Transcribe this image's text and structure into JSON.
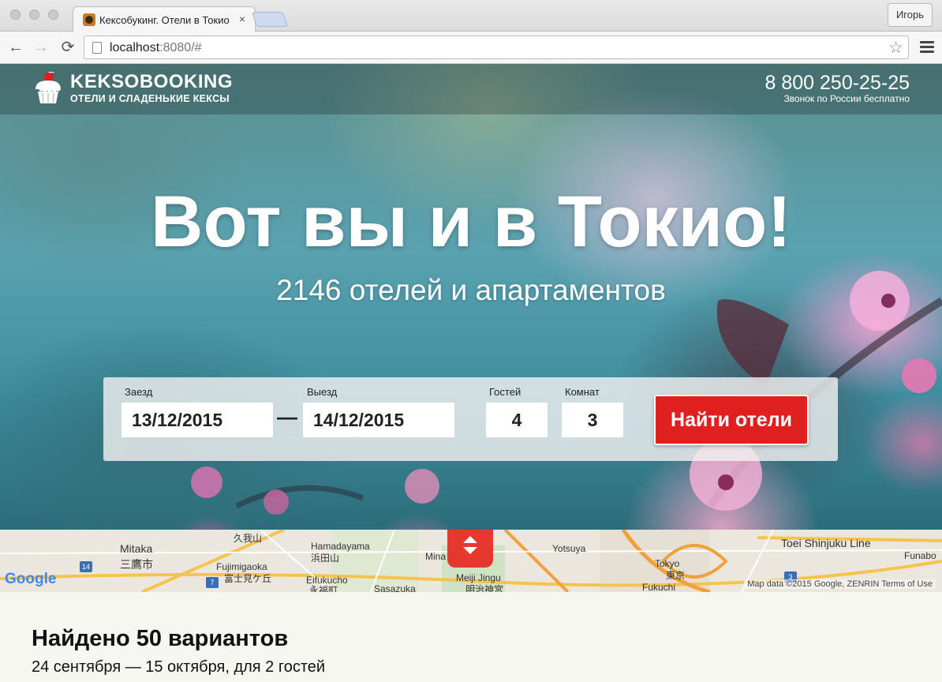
{
  "browser": {
    "tab_title": "Кексобукинг. Отели в Токио",
    "tab_close": "×",
    "profile_name": "Игорь",
    "url_host": "localhost",
    "url_rest": ":8080/#",
    "star_glyph": "☆",
    "back_glyph": "←",
    "forward_glyph": "→",
    "reload_glyph": "⟳"
  },
  "header": {
    "logo_name": "KEKSOBOOKING",
    "logo_tagline": "ОТЕЛИ И СЛАДЕНЬКИЕ КЕКСЫ",
    "phone": "8 800 250-25-25",
    "phone_note": "Звонок по России бесплатно"
  },
  "hero": {
    "title": "Вот вы и в Токио!",
    "subtitle": "2146 отелей и апартаментов"
  },
  "search": {
    "checkin_label": "Заезд",
    "checkin_value": "13/12/2015",
    "dash": "—",
    "checkout_label": "Выезд",
    "checkout_value": "14/12/2015",
    "guests_label": "Гостей",
    "guests_value": "4",
    "rooms_label": "Комнат",
    "rooms_value": "3",
    "submit_label": "Найти отели"
  },
  "map": {
    "labels": {
      "mitaka": "Mitaka",
      "mitaka_jp": "三鷹市",
      "hamadayama": "Hamadayama",
      "hamadayama_jp": "浜田山",
      "fujimigaoka": "Fujimigaoka",
      "fujimigaoka_jp": "富士見ケ丘",
      "eifukucho": "Eifukucho",
      "eifukucho_jp": "永福町",
      "sasazuka": "Sasazuka",
      "kugayama_jp": "久我山",
      "minami": "Mina",
      "meiji_jingu": "Meiji Jingu",
      "meiji_jingu_jp": "明治神宮",
      "yotsuya": "Yotsuya",
      "tokyo": "Tokyo",
      "tokyo_jp": "東京",
      "ebisu": "Fukuchi",
      "shinjuku_line": "Toei Shinjuku Line",
      "funabori": "Funabo"
    },
    "route_shields": [
      "14",
      "7",
      "3"
    ],
    "google_logo": "Google",
    "attribution": "Map data ©2015 Google, ZENRIN   Terms of Use"
  },
  "results": {
    "title": "Найдено 50 вариантов",
    "dates": "24 сентября  —  15 октября, для 2 гостей"
  },
  "colors": {
    "accent_red": "#e0201f",
    "map_toggle": "#e5392f",
    "page_background": "#f7f7f2"
  },
  "icons": [
    "cupcake-logo-icon",
    "favicon-icon",
    "back-arrow-icon",
    "forward-arrow-icon",
    "reload-icon",
    "page-icon",
    "bookmark-star-icon",
    "hamburger-menu-icon",
    "map-toggle-icon"
  ]
}
